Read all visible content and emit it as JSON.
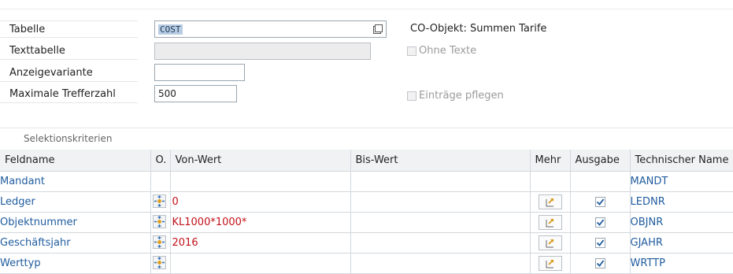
{
  "form": {
    "tabelle": {
      "label": "Tabelle",
      "value": "COST"
    },
    "texttabelle": {
      "label": "Texttabelle",
      "value": ""
    },
    "anzeigevariante": {
      "label": "Anzeigevariante",
      "value": ""
    },
    "trefferzahl": {
      "label": "Maximale Trefferzahl",
      "value": "500"
    },
    "co_objekt": "CO-Objekt: Summen Tarife",
    "ohne_texte": "Ohne Texte",
    "eintraege_pflegen": "Einträge pflegen"
  },
  "section_title": "Selektionskriterien",
  "columns": [
    "Feldname",
    "O.",
    "Von-Wert",
    "Bis-Wert",
    "Mehr",
    "Ausgabe",
    "Technischer Name"
  ],
  "rows": [
    {
      "feldname": "Mandant",
      "von": "",
      "has_op": false,
      "has_more": false,
      "ausgabe": false,
      "tech": "MANDT"
    },
    {
      "feldname": "Ledger",
      "von": "0",
      "has_op": true,
      "has_more": true,
      "ausgabe": true,
      "tech": "LEDNR"
    },
    {
      "feldname": "Objektnummer",
      "von": "KL1000*1000*",
      "has_op": true,
      "has_more": true,
      "ausgabe": true,
      "tech": "OBJNR"
    },
    {
      "feldname": "Geschäftsjahr",
      "von": "2016",
      "has_op": true,
      "has_more": true,
      "ausgabe": true,
      "tech": "GJAHR"
    },
    {
      "feldname": "Werttyp",
      "von": "",
      "has_op": true,
      "has_more": true,
      "ausgabe": true,
      "tech": "WRTTP"
    }
  ],
  "icons": {
    "f4": "value-help-icon",
    "op": "selection-option-icon",
    "more": "multiple-selection-icon",
    "check": "checkmark-icon"
  },
  "colors": {
    "field_link": "#1f5c9e",
    "value_red": "#c0101a",
    "header_bg": "#f0f2f4",
    "checkmark": "#1f5c9e"
  }
}
